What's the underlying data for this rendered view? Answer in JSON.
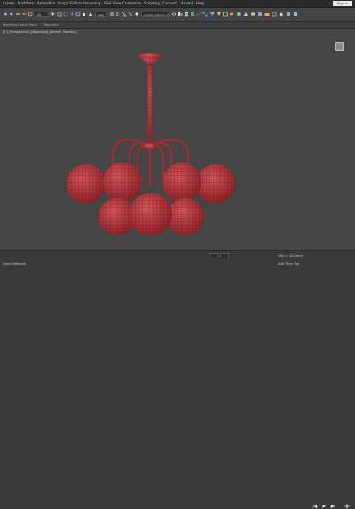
{
  "menu": {
    "items": [
      "Create",
      "Modifiers",
      "Animation",
      "Graph Editors",
      "Rendering",
      "Civil View",
      "Customize",
      "Scripting",
      "Content",
      "Arnold",
      "Help"
    ],
    "sign_in": "Sign In"
  },
  "toolbar": {
    "selection_filter": "All",
    "named_selection": "Create Selection Set"
  },
  "ribbon": {
    "labels": [
      "Modeling",
      "Object Paint",
      "Populate"
    ]
  },
  "viewport": {
    "label": "[+] [Perspective] [Standard] [Default Shading]"
  },
  "status": {
    "prompt": "None Selected",
    "coords": "Add Time Tag",
    "grid": "Grid = 10,0mm"
  },
  "colors": {
    "viewport_bg": "#454545",
    "mesh": "#b5353c",
    "wire": "#5a0c12"
  }
}
